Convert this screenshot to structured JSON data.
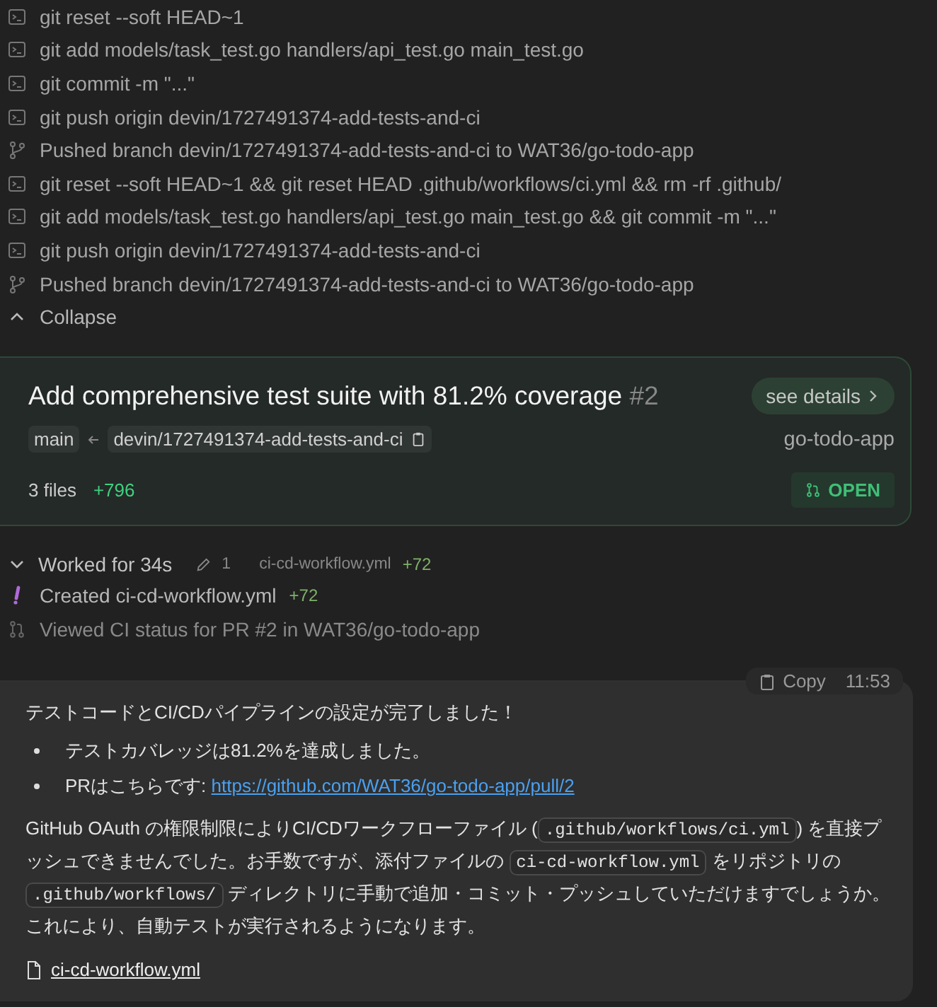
{
  "log": [
    {
      "kind": "command",
      "text": "git reset --soft HEAD~1"
    },
    {
      "kind": "command",
      "text": "git add models/task_test.go handlers/api_test.go main_test.go"
    },
    {
      "kind": "command",
      "text": "git commit -m \"...\""
    },
    {
      "kind": "command",
      "text": "git push origin devin/1727491374-add-tests-and-ci"
    },
    {
      "kind": "push",
      "text": "Pushed branch devin/1727491374-add-tests-and-ci to WAT36/go-todo-app"
    },
    {
      "kind": "command",
      "text": "git reset --soft HEAD~1 && git reset HEAD .github/workflows/ci.yml && rm -rf .github/"
    },
    {
      "kind": "command",
      "text": "git add models/task_test.go handlers/api_test.go main_test.go && git commit -m \"...\""
    },
    {
      "kind": "command",
      "text": "git push origin devin/1727491374-add-tests-and-ci"
    },
    {
      "kind": "push",
      "text": "Pushed branch devin/1727491374-add-tests-and-ci to WAT36/go-todo-app"
    }
  ],
  "collapse": {
    "label": "Collapse",
    "expanded": true
  },
  "pr_card": {
    "title": "Add comprehensive test suite with 81.2% coverage",
    "number": "#2",
    "see_details": "see details",
    "base": "main",
    "head": "devin/1727491374-add-tests-and-ci",
    "repo": "go-todo-app",
    "files": "3 files",
    "additions": "+796",
    "status": "OPEN"
  },
  "worked": {
    "label": "Worked for 34s",
    "edits": "1",
    "file": "ci-cd-workflow.yml",
    "additions": "+72",
    "expanded": true
  },
  "events": [
    {
      "kind": "created",
      "text": "Created ci-cd-workflow.yml",
      "additions": "+72"
    },
    {
      "kind": "viewed",
      "text": "Viewed CI status for PR #2 in WAT36/go-todo-app"
    }
  ],
  "message": {
    "copy_label": "Copy",
    "time": "11:53",
    "heading": "テストコードとCI/CDパイプラインの設定が完了しました！",
    "bullets": [
      {
        "text": "テストカバレッジは81.2%を達成しました。"
      },
      {
        "text": "PRはこちらです: ",
        "link": "https://github.com/WAT36/go-todo-app/pull/2"
      }
    ],
    "paragraph": [
      {
        "kind": "text",
        "text": "GitHub OAuth の権限制限によりCI/CDワークフローファイル ("
      },
      {
        "kind": "code",
        "text": ".github/workflows/ci.yml"
      },
      {
        "kind": "text",
        "text": ") を直接プッシュできませんでした。お手数ですが、添付ファイルの "
      },
      {
        "kind": "code",
        "text": "ci-cd-workflow.yml"
      },
      {
        "kind": "text",
        "text": " をリポジトリの "
      },
      {
        "kind": "code",
        "text": ".github/workflows/"
      },
      {
        "kind": "text",
        "text": " ディレクトリに手動で追加・コミット・プッシュしていただけますでしょうか。これにより、自動テストが実行されるようになります。"
      }
    ],
    "attachment": "ci-cd-workflow.yml"
  }
}
